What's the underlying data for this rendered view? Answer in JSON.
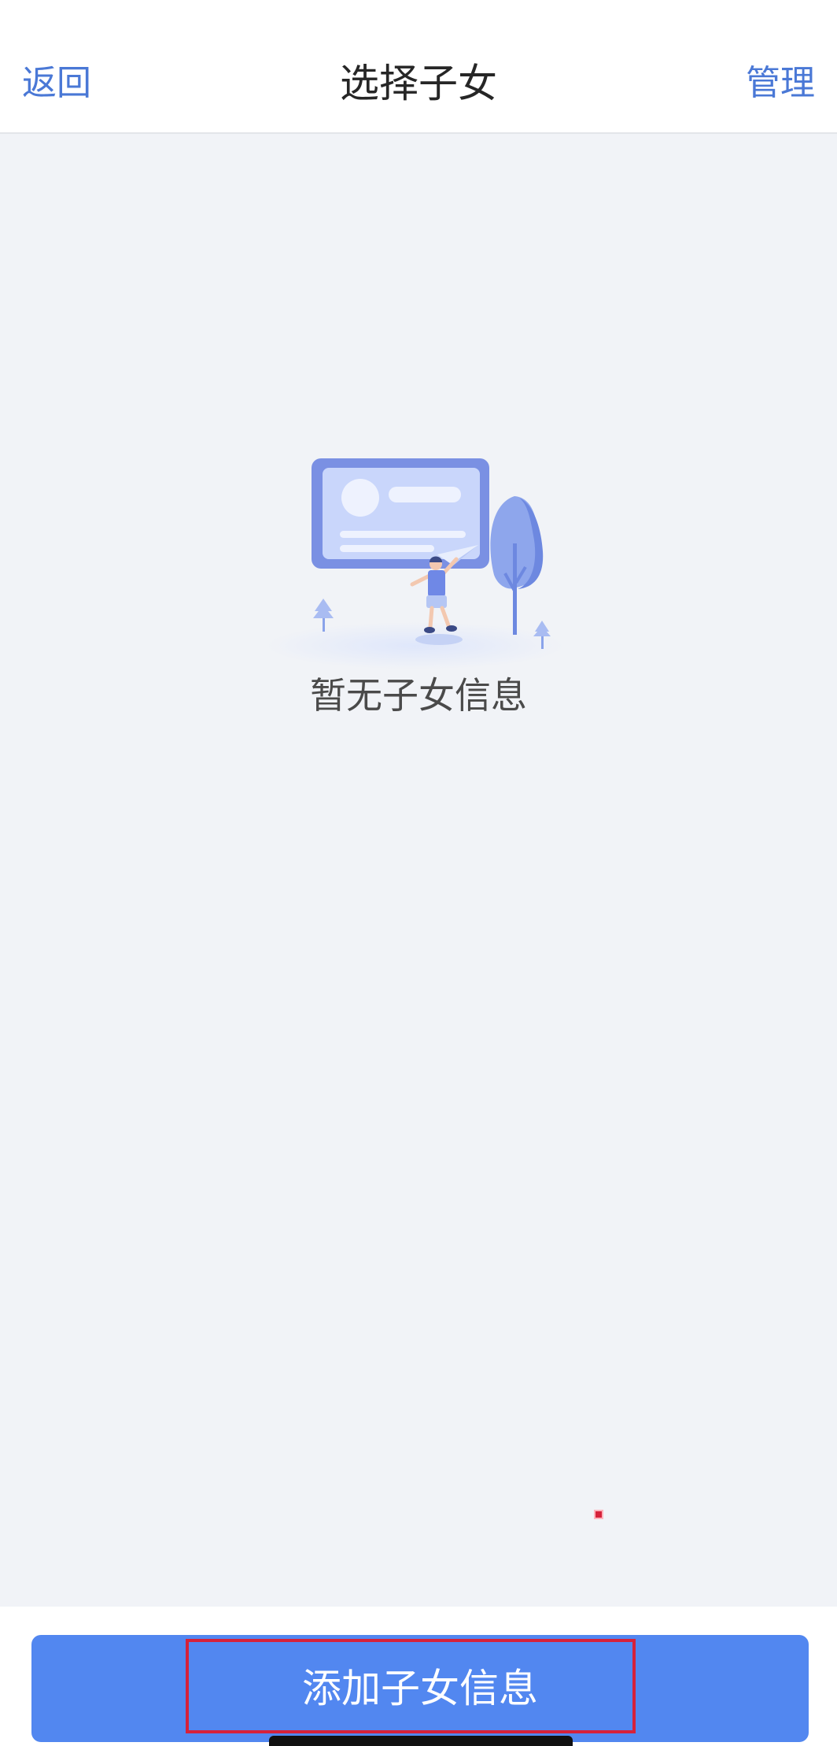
{
  "nav": {
    "back_label": "返回",
    "title": "选择子女",
    "manage_label": "管理"
  },
  "empty_state": {
    "illustration_icon": "empty-profile-card-illustration",
    "message": "暂无子女信息"
  },
  "footer": {
    "add_button_label": "添加子女信息"
  },
  "colors": {
    "link": "#4a78d6",
    "primary_button": "#5287f0",
    "background": "#f1f3f7",
    "highlight": "#d6213a"
  }
}
